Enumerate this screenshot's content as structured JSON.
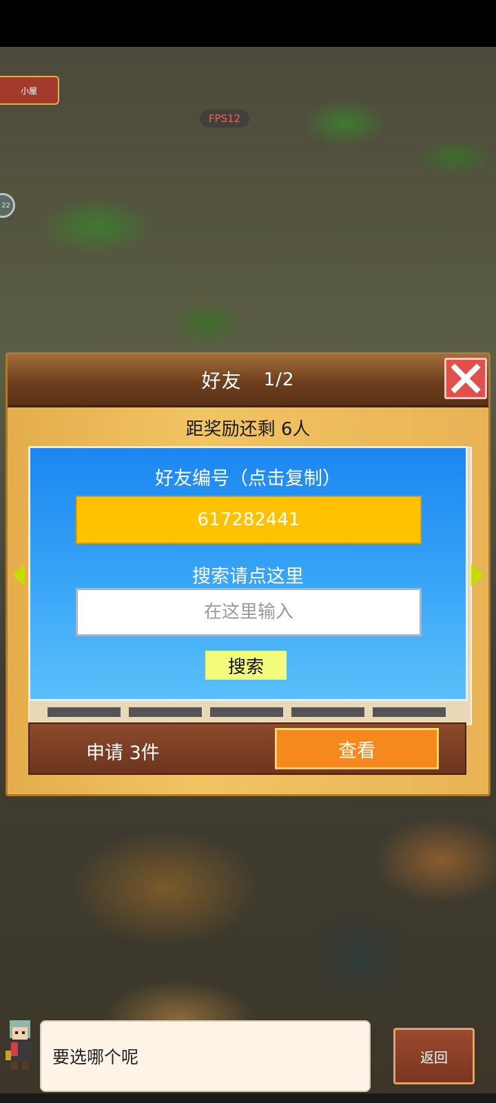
{
  "map": {
    "hut_label": "小屋",
    "fps_label": "FPS12",
    "side_badge": "22"
  },
  "dialog": {
    "title": "好友",
    "page": "1/2",
    "reward_text": "距奖励还剩 6人",
    "friend_code_title": "好友编号（点击复制）",
    "friend_code": "617282441",
    "search_title": "搜索请点这里",
    "search_placeholder": "在这里输入",
    "search_button": "搜索",
    "requests_text": "申请 3件",
    "view_button": "查看"
  },
  "footer": {
    "message": "要选哪个呢",
    "back_button": "返回"
  },
  "colors": {
    "header_brown": "#6d3f1e",
    "panel_blue": "#1b86f0",
    "code_yellow": "#ffc200",
    "view_orange": "#f5891e",
    "close_red": "#e2504b"
  }
}
